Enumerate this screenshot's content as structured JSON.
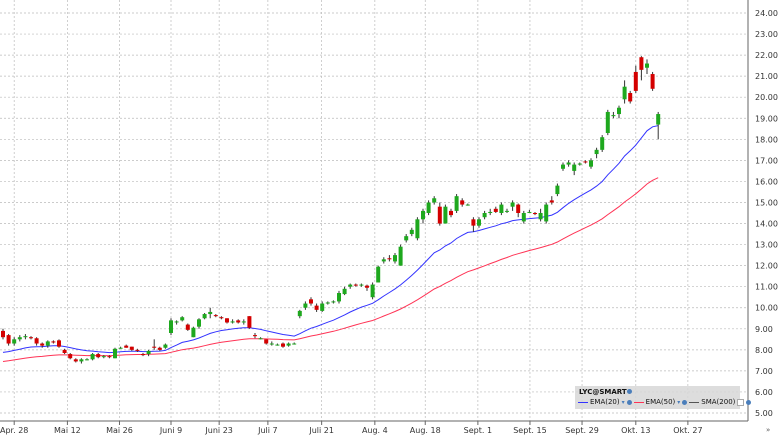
{
  "chart_data": {
    "type": "candlestick",
    "title": "",
    "symbol": "LYC@SMART",
    "ylim": [
      5,
      24
    ],
    "y_ticks": [
      "5.00",
      "6.00",
      "7.00",
      "8.00",
      "9.00",
      "10.00",
      "11.00",
      "12.00",
      "13.00",
      "14.00",
      "15.00",
      "16.00",
      "17.00",
      "18.00",
      "19.00",
      "20.00",
      "21.00",
      "22.00",
      "23.00",
      "24.00"
    ],
    "x_ticks": [
      {
        "label": "Apr. 28",
        "index": 2
      },
      {
        "label": "Mai 12",
        "index": 11.5
      },
      {
        "label": "Mai 26",
        "index": 20.8
      },
      {
        "label": "Juni 9",
        "index": 30
      },
      {
        "label": "Juni 23",
        "index": 38.6
      },
      {
        "label": "Juli 7",
        "index": 47.3
      },
      {
        "label": "Juli 21",
        "index": 56.9
      },
      {
        "label": "Aug. 4",
        "index": 66.4
      },
      {
        "label": "Aug. 18",
        "index": 75.4
      },
      {
        "label": "Sept. 1",
        "index": 84.8
      },
      {
        "label": "Sept. 15",
        "index": 94.1
      },
      {
        "label": "Sept. 29",
        "index": 103.4
      },
      {
        "label": "Okt. 13",
        "index": 113
      },
      {
        "label": "Okt. 27",
        "index": 122.3
      }
    ],
    "ohlc": [
      [
        8.9,
        9.0,
        8.5,
        8.6
      ],
      [
        8.7,
        8.75,
        8.2,
        8.3
      ],
      [
        8.3,
        8.6,
        8.2,
        8.5
      ],
      [
        8.5,
        8.7,
        8.4,
        8.6
      ],
      [
        8.6,
        8.75,
        8.5,
        8.65
      ],
      [
        8.6,
        8.65,
        8.5,
        8.55
      ],
      [
        8.55,
        8.6,
        8.2,
        8.3
      ],
      [
        8.3,
        8.35,
        8.1,
        8.2
      ],
      [
        8.2,
        8.45,
        8.1,
        8.4
      ],
      [
        8.4,
        8.45,
        8.3,
        8.35
      ],
      [
        8.45,
        8.5,
        8.1,
        8.15
      ],
      [
        8.0,
        8.05,
        7.8,
        7.85
      ],
      [
        7.8,
        7.85,
        7.55,
        7.6
      ],
      [
        7.55,
        7.6,
        7.4,
        7.45
      ],
      [
        7.45,
        7.6,
        7.35,
        7.55
      ],
      [
        7.55,
        7.6,
        7.5,
        7.55
      ],
      [
        7.55,
        7.85,
        7.5,
        7.8
      ],
      [
        7.8,
        7.85,
        7.6,
        7.65
      ],
      [
        7.7,
        7.75,
        7.6,
        7.7
      ],
      [
        7.7,
        7.75,
        7.6,
        7.65
      ],
      [
        7.6,
        8.1,
        7.6,
        8.05
      ],
      [
        8.1,
        8.15,
        8.05,
        8.1
      ],
      [
        8.2,
        8.25,
        8.1,
        8.1
      ],
      [
        8.15,
        8.15,
        7.95,
        8.0
      ],
      [
        8.0,
        8.05,
        7.9,
        7.95
      ],
      [
        7.8,
        7.85,
        7.7,
        7.75
      ],
      [
        7.8,
        8.0,
        7.7,
        7.95
      ],
      [
        8.15,
        8.5,
        8.0,
        8.1
      ],
      [
        8.1,
        8.15,
        7.95,
        8.0
      ],
      [
        8.1,
        8.3,
        8.05,
        8.25
      ],
      [
        8.8,
        9.5,
        8.7,
        9.4
      ],
      [
        9.3,
        9.4,
        9.2,
        9.35
      ],
      [
        9.4,
        9.6,
        9.35,
        9.55
      ],
      [
        9.2,
        9.25,
        8.9,
        8.95
      ],
      [
        8.6,
        9.1,
        8.6,
        9.05
      ],
      [
        9.1,
        9.5,
        9.0,
        9.45
      ],
      [
        9.5,
        9.75,
        9.45,
        9.7
      ],
      [
        9.7,
        10.0,
        9.5,
        9.8
      ],
      [
        9.65,
        9.7,
        9.55,
        9.6
      ],
      [
        9.55,
        9.6,
        9.45,
        9.5
      ],
      [
        9.5,
        9.5,
        9.25,
        9.3
      ],
      [
        9.3,
        9.45,
        9.25,
        9.35
      ],
      [
        9.4,
        9.45,
        9.25,
        9.3
      ],
      [
        9.3,
        9.45,
        9.2,
        9.35
      ],
      [
        9.6,
        9.6,
        9.0,
        9.05
      ],
      [
        8.7,
        8.8,
        8.55,
        8.65
      ],
      [
        8.55,
        8.6,
        8.5,
        8.55
      ],
      [
        8.5,
        8.5,
        8.25,
        8.3
      ],
      [
        8.3,
        8.4,
        8.2,
        8.3
      ],
      [
        8.25,
        8.3,
        8.2,
        8.25
      ],
      [
        8.3,
        8.35,
        8.1,
        8.15
      ],
      [
        8.2,
        8.35,
        8.15,
        8.3
      ],
      [
        8.3,
        8.35,
        8.25,
        8.3
      ],
      [
        9.6,
        9.9,
        9.5,
        9.85
      ],
      [
        10.0,
        10.3,
        9.9,
        10.2
      ],
      [
        10.4,
        10.5,
        10.1,
        10.2
      ],
      [
        10.1,
        10.2,
        9.8,
        9.9
      ],
      [
        9.85,
        10.3,
        9.8,
        10.2
      ],
      [
        10.2,
        10.3,
        10.15,
        10.25
      ],
      [
        10.3,
        10.35,
        10.2,
        10.3
      ],
      [
        10.3,
        10.8,
        10.2,
        10.7
      ],
      [
        10.65,
        11.0,
        10.6,
        10.9
      ],
      [
        11.0,
        11.15,
        10.9,
        11.1
      ],
      [
        11.1,
        11.15,
        11.0,
        11.05
      ],
      [
        11.1,
        11.15,
        11.0,
        11.1
      ],
      [
        11.05,
        11.1,
        10.8,
        10.95
      ],
      [
        10.5,
        11.2,
        10.4,
        11.1
      ],
      [
        11.2,
        12.0,
        11.2,
        11.95
      ],
      [
        12.2,
        12.4,
        12.1,
        12.3
      ],
      [
        12.35,
        12.5,
        12.2,
        12.3
      ],
      [
        12.2,
        12.6,
        12.1,
        12.5
      ],
      [
        12.0,
        13.0,
        12.0,
        12.9
      ],
      [
        13.2,
        13.5,
        13.1,
        13.4
      ],
      [
        13.5,
        13.8,
        13.4,
        13.7
      ],
      [
        13.3,
        14.3,
        13.2,
        14.2
      ],
      [
        14.2,
        14.7,
        14.0,
        14.6
      ],
      [
        14.5,
        15.1,
        14.4,
        15.0
      ],
      [
        15.0,
        15.3,
        14.9,
        15.2
      ],
      [
        14.8,
        15.0,
        13.9,
        14.0
      ],
      [
        14.0,
        14.9,
        14.0,
        14.8
      ],
      [
        14.6,
        14.7,
        14.3,
        14.4
      ],
      [
        14.6,
        15.4,
        14.5,
        15.3
      ],
      [
        15.1,
        15.2,
        14.8,
        14.9
      ],
      [
        14.9,
        14.95,
        14.85,
        14.9
      ],
      [
        14.2,
        14.3,
        13.6,
        13.9
      ],
      [
        13.9,
        14.3,
        13.8,
        14.2
      ],
      [
        14.3,
        14.6,
        14.2,
        14.5
      ],
      [
        14.5,
        14.7,
        14.4,
        14.55
      ],
      [
        14.7,
        14.8,
        14.5,
        14.55
      ],
      [
        14.5,
        15.0,
        14.4,
        14.9
      ],
      [
        14.6,
        14.7,
        14.5,
        14.6
      ],
      [
        14.8,
        15.1,
        14.6,
        15.0
      ],
      [
        14.9,
        14.95,
        14.3,
        14.5
      ],
      [
        14.1,
        14.6,
        14.0,
        14.5
      ],
      [
        14.55,
        14.65,
        14.5,
        14.55
      ],
      [
        14.5,
        14.55,
        14.4,
        14.45
      ],
      [
        14.2,
        14.7,
        14.1,
        14.5
      ],
      [
        14.1,
        15.0,
        14.0,
        14.9
      ],
      [
        15.1,
        15.3,
        14.9,
        15.0
      ],
      [
        15.4,
        15.9,
        15.3,
        15.8
      ],
      [
        16.6,
        16.9,
        16.5,
        16.8
      ],
      [
        16.8,
        17.0,
        16.7,
        16.9
      ],
      [
        16.5,
        16.9,
        16.3,
        16.8
      ],
      [
        16.8,
        16.9,
        16.75,
        16.85
      ],
      [
        16.95,
        17.0,
        16.85,
        16.9
      ],
      [
        16.7,
        17.1,
        16.6,
        17.0
      ],
      [
        17.3,
        17.6,
        17.1,
        17.5
      ],
      [
        17.5,
        18.2,
        17.4,
        18.1
      ],
      [
        18.3,
        19.4,
        18.2,
        19.3
      ],
      [
        19.1,
        19.3,
        19.0,
        19.15
      ],
      [
        19.2,
        19.6,
        19.0,
        19.5
      ],
      [
        19.9,
        20.8,
        19.7,
        20.5
      ],
      [
        20.2,
        20.3,
        19.7,
        19.8
      ],
      [
        21.2,
        21.5,
        20.2,
        20.3
      ],
      [
        21.9,
        21.95,
        20.8,
        21.3
      ],
      [
        21.4,
        21.8,
        21.1,
        21.6
      ],
      [
        21.1,
        21.2,
        20.3,
        20.4
      ],
      [
        18.7,
        19.3,
        18.0,
        19.2
      ]
    ],
    "series": [
      {
        "name": "EMA(20)",
        "period": 20,
        "seed": 7.8,
        "color": "#3333ff",
        "visible": true
      },
      {
        "name": "EMA(50)",
        "period": 50,
        "seed": 7.4,
        "color": "#ff3355",
        "visible": true
      },
      {
        "name": "SMA(200)",
        "period": 200,
        "color": "#555555",
        "visible": false
      }
    ],
    "colors": {
      "up": "#1ea81e",
      "down": "#d40000",
      "grid": "#bbbbbb"
    },
    "grid": true,
    "legend": "bottom-right"
  },
  "more_icon": "»"
}
